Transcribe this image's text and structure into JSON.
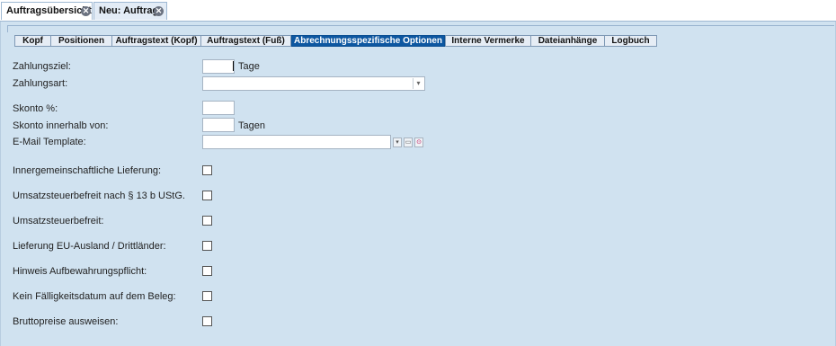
{
  "doc_tabs": [
    {
      "label": "Auftragsübersicht",
      "close_icon": "close-icon"
    },
    {
      "label": "Neu: Auftrag",
      "close_icon": "close-icon"
    }
  ],
  "sub_tabs": [
    {
      "label": "Kopf"
    },
    {
      "label": "Positionen"
    },
    {
      "label": "Auftragstext (Kopf)"
    },
    {
      "label": "Auftragstext (Fuß)"
    },
    {
      "label": "Abrechnungsspezifische Optionen",
      "active": true
    },
    {
      "label": "Interne Vermerke"
    },
    {
      "label": "Dateianhänge"
    },
    {
      "label": "Logbuch"
    }
  ],
  "form": {
    "zahlungsziel": {
      "label": "Zahlungsziel:",
      "value": "",
      "unit": "Tage"
    },
    "zahlungsart": {
      "label": "Zahlungsart:",
      "value": ""
    },
    "skonto_pct": {
      "label": "Skonto %:",
      "value": ""
    },
    "skonto_days": {
      "label": "Skonto innerhalb von:",
      "value": "",
      "unit": "Tagen"
    },
    "email_template": {
      "label": "E-Mail Template:",
      "value": ""
    }
  },
  "checkboxes": [
    {
      "label": "Innergemeinschaftliche Lieferung:",
      "checked": false
    },
    {
      "label": "Umsatzsteuerbefreit nach § 13 b UStG.",
      "checked": false
    },
    {
      "label": "Umsatzsteuerbefreit:",
      "checked": false
    },
    {
      "label": "Lieferung EU-Ausland / Drittländer:",
      "checked": false
    },
    {
      "label": "Hinweis Aufbewahrungspflicht:",
      "checked": false
    },
    {
      "label": "Kein Fälligkeitsdatum auf dem Beleg:",
      "checked": false
    },
    {
      "label": "Bruttopreise ausweisen:",
      "checked": false
    }
  ],
  "colors": {
    "active_tab": "#0d57a1",
    "panel_bg": "#d0e2f0"
  }
}
